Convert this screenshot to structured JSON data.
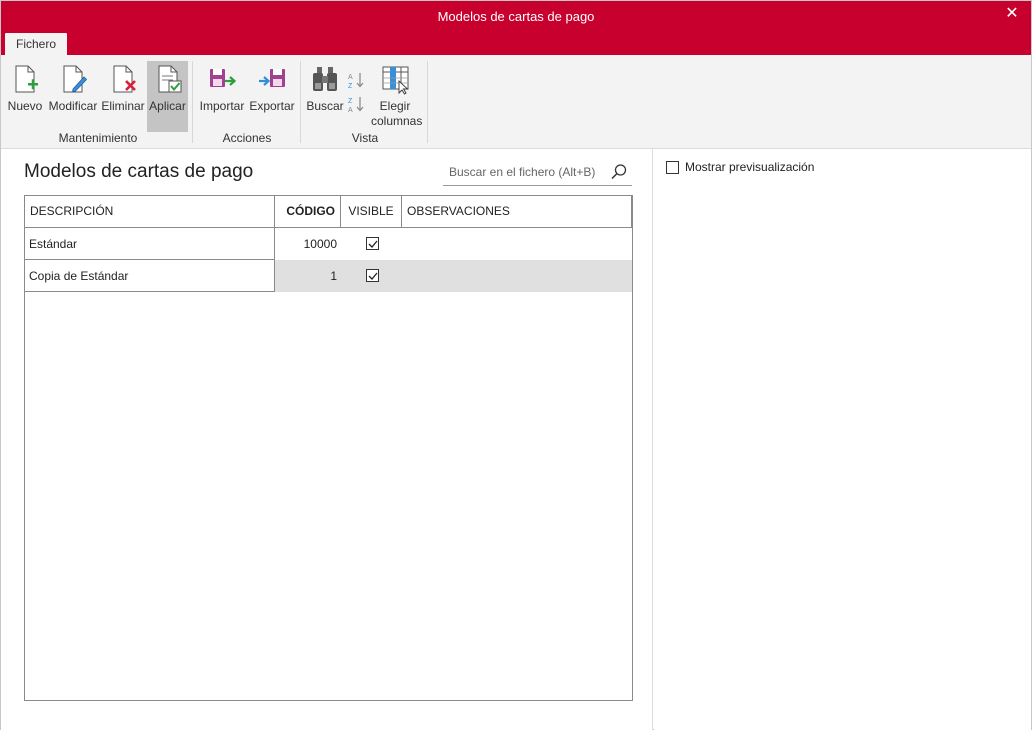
{
  "window": {
    "title": "Modelos de cartas de pago",
    "close_glyph": "✕"
  },
  "tabs": [
    {
      "label": "Fichero",
      "active": true
    }
  ],
  "ribbon": {
    "groups": [
      {
        "label": "Mantenimiento",
        "buttons": [
          {
            "label": "Nuevo",
            "icon": "new-document-icon"
          },
          {
            "label": "Modificar",
            "icon": "edit-document-icon"
          },
          {
            "label": "Eliminar",
            "icon": "delete-document-icon"
          },
          {
            "label": "Aplicar",
            "icon": "apply-document-icon",
            "active": true
          }
        ]
      },
      {
        "label": "Acciones",
        "buttons": [
          {
            "label": "Importar",
            "icon": "import-icon"
          },
          {
            "label": "Exportar",
            "icon": "export-icon"
          }
        ]
      },
      {
        "label": "Vista",
        "buttons": [
          {
            "label": "Buscar",
            "icon": "binoculars-icon"
          },
          {
            "label": "Elegir columnas",
            "label_line1": "Elegir",
            "label_line2": "columnas",
            "icon": "choose-columns-icon"
          }
        ],
        "small_buttons": [
          {
            "icon": "sort-ascending-icon",
            "label": "A Z"
          },
          {
            "icon": "sort-descending-icon",
            "label": "Z A"
          }
        ]
      }
    ]
  },
  "main": {
    "title": "Modelos de cartas de pago",
    "search": {
      "placeholder": "Buscar en el fichero (Alt+B)",
      "value": ""
    },
    "table": {
      "columns": [
        "DESCRIPCIÓN",
        "CÓDIGO",
        "VISIBLE",
        "OBSERVACIONES"
      ],
      "sorted_column": "CÓDIGO",
      "rows": [
        {
          "descripcion": "Estándar",
          "codigo": "10000",
          "visible": true,
          "observaciones": "",
          "selected": false
        },
        {
          "descripcion": "Copia de Estándar",
          "codigo": "1",
          "visible": true,
          "observaciones": "",
          "selected": true
        }
      ]
    }
  },
  "preview": {
    "label": "Mostrar previsualización",
    "checked": false
  },
  "colors": {
    "titlebar": "#c8002d",
    "ribbon_bg": "#f3f3f3",
    "selected_row": "#e0e0e0",
    "active_button": "#c4c4c4"
  }
}
